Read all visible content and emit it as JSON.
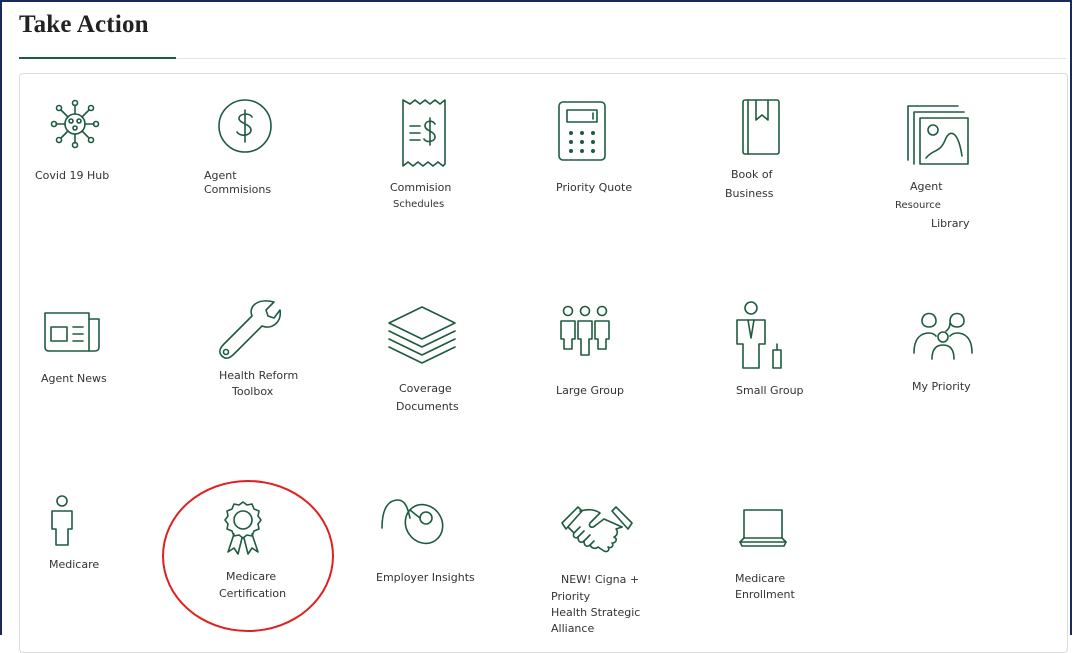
{
  "page": {
    "title": "Take Action"
  },
  "colors": {
    "icon_green": "#1e5b3f",
    "frame_navy": "#1a2a5e",
    "highlight_red": "#e02020"
  },
  "tiles": [
    {
      "icon": "covid-virus-icon",
      "lines": [
        "Covid 19 Hub"
      ]
    },
    {
      "icon": "dollar-circle-icon",
      "lines": [
        "Agent",
        "Commisions"
      ]
    },
    {
      "icon": "receipt-icon",
      "lines": [
        "Commision",
        "Schedules"
      ]
    },
    {
      "icon": "calculator-icon",
      "lines": [
        "Priority Quote"
      ]
    },
    {
      "icon": "bookmarked-book-icon",
      "lines": [
        "Book of",
        "Business"
      ]
    },
    {
      "icon": "image-gallery-icon",
      "lines": [
        "Agent",
        "Resource",
        "Library"
      ]
    },
    {
      "icon": "newspaper-icon",
      "lines": [
        "Agent News"
      ]
    },
    {
      "icon": "wrench-icon",
      "lines": [
        "Health Reform",
        "Toolbox"
      ]
    },
    {
      "icon": "layers-stack-icon",
      "lines": [
        "Coverage",
        "Documents"
      ]
    },
    {
      "icon": "group-of-people-icon",
      "lines": [
        "Large Group"
      ]
    },
    {
      "icon": "businessperson-icon",
      "lines": [
        "Small Group"
      ]
    },
    {
      "icon": "family-icon",
      "lines": [
        "My Priority"
      ]
    },
    {
      "icon": "person-icon",
      "lines": [
        "Medicare"
      ]
    },
    {
      "icon": "award-ribbon-icon",
      "lines": [
        "Medicare",
        "Certification"
      ]
    },
    {
      "icon": "computer-mouse-icon",
      "lines": [
        "Employer Insights"
      ]
    },
    {
      "icon": "handshake-icon",
      "lines": [
        "NEW! Cigna +",
        "Priority",
        "Health Strategic",
        "Alliance"
      ]
    },
    {
      "icon": "laptop-icon",
      "lines": [
        "Medicare",
        "Enrollment"
      ]
    }
  ]
}
